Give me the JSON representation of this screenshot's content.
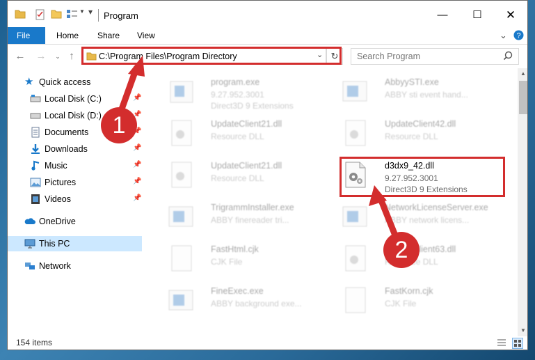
{
  "window": {
    "title": "Program"
  },
  "ribbon": {
    "tabs": [
      "File",
      "Home",
      "Share",
      "View"
    ]
  },
  "address": {
    "path": "C:\\Program Files\\Program Directory"
  },
  "search": {
    "placeholder": "Search Program"
  },
  "nav": {
    "quick_access": "Quick access",
    "items": [
      {
        "label": "Local Disk (C:)",
        "icon": "drive-icon"
      },
      {
        "label": "Local Disk (D:)",
        "icon": "drive-icon"
      },
      {
        "label": "Documents",
        "icon": "documents-icon"
      },
      {
        "label": "Downloads",
        "icon": "downloads-icon"
      },
      {
        "label": "Music",
        "icon": "music-icon"
      },
      {
        "label": "Pictures",
        "icon": "pictures-icon"
      },
      {
        "label": "Videos",
        "icon": "videos-icon"
      }
    ],
    "onedrive": "OneDrive",
    "this_pc": "This PC",
    "network": "Network"
  },
  "files": [
    {
      "name": "program.exe",
      "l2": "9.27.952.3001",
      "l3": "Direct3D 9 Extensions",
      "icon": "exe-icon"
    },
    {
      "name": "AbbyySTI.exe",
      "l2": "ABBY sti event hand...",
      "l3": "",
      "icon": "exe-icon"
    },
    {
      "name": "UpdateClient21.dll",
      "l2": "Resource DLL",
      "l3": "",
      "icon": "dll-icon"
    },
    {
      "name": "UpdateClient42.dll",
      "l2": "Resource DLL",
      "l3": "",
      "icon": "dll-icon"
    },
    {
      "name": "UpdateClient21.dll",
      "l2": "Resource DLL",
      "l3": "",
      "icon": "dll-icon"
    },
    {
      "name": "d3dx9_42.dll",
      "l2": "9.27.952.3001",
      "l3": "Direct3D 9 Extensions",
      "icon": "dll-icon"
    },
    {
      "name": "TrigrammInstaller.exe",
      "l2": "ABBY finereader tri...",
      "l3": "",
      "icon": "exe-icon"
    },
    {
      "name": "NetworkLicenseServer.exe",
      "l2": "ABBY network licens...",
      "l3": "",
      "icon": "exe-icon"
    },
    {
      "name": "FastHtml.cjk",
      "l2": "CJK File",
      "l3": "",
      "icon": "file-icon"
    },
    {
      "name": "UpdateClient63.dll",
      "l2": "Resource DLL",
      "l3": "",
      "icon": "dll-icon"
    },
    {
      "name": "FineExec.exe",
      "l2": "ABBY background exe...",
      "l3": "",
      "icon": "exe-icon"
    },
    {
      "name": "FastKorn.cjk",
      "l2": "CJK File",
      "l3": "",
      "icon": "file-icon"
    }
  ],
  "status": {
    "count": "154 items"
  },
  "annotations": {
    "badge1": "1",
    "badge2": "2"
  },
  "colors": {
    "accent": "#1979ca",
    "highlight_red": "#d32d2d",
    "selected": "#cce8ff"
  }
}
